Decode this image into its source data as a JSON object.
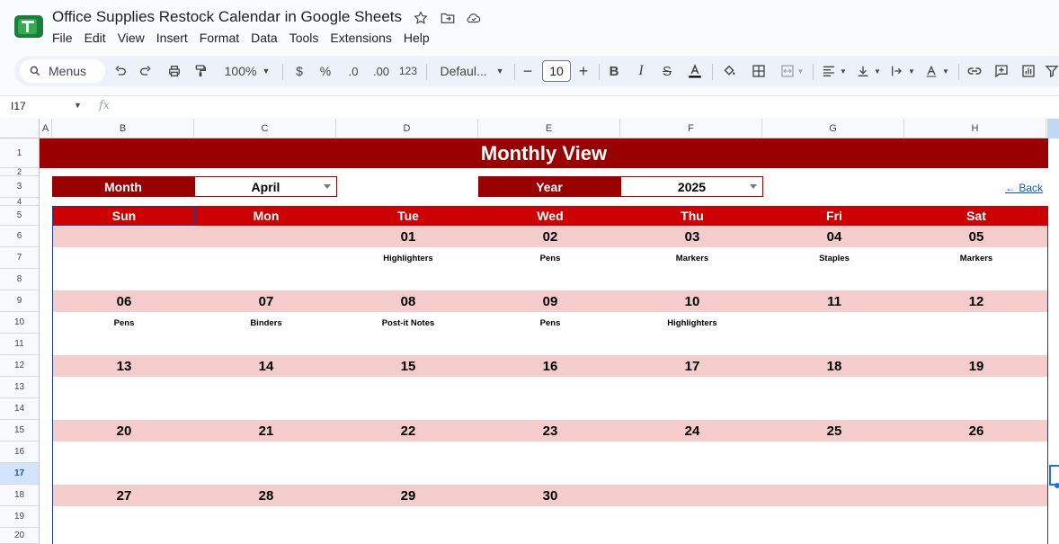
{
  "app": {
    "doc_title": "Office Supplies Restock Calendar in Google Sheets",
    "menu": [
      "File",
      "Edit",
      "View",
      "Insert",
      "Format",
      "Data",
      "Tools",
      "Extensions",
      "Help"
    ]
  },
  "toolbar": {
    "search_label": "Menus",
    "zoom": "100%",
    "currency": "$",
    "percent": "%",
    "dec_less": ".0",
    "dec_more": ".00",
    "number_format": "123",
    "font_family": "Defaul...",
    "font_size": "10"
  },
  "formula_bar": {
    "cell_ref": "I17",
    "fx_label": "fx"
  },
  "grid": {
    "columns": [
      "A",
      "B",
      "C",
      "D",
      "E",
      "F",
      "G",
      "H"
    ],
    "rows": [
      "1",
      "2",
      "3",
      "4",
      "5",
      "6",
      "7",
      "8",
      "9",
      "10",
      "11",
      "12",
      "13",
      "14",
      "15",
      "16",
      "17",
      "18",
      "19",
      "20"
    ],
    "active_row": "17"
  },
  "calendar": {
    "title": "Monthly View",
    "month_label": "Month",
    "month_value": "April",
    "year_label": "Year",
    "year_value": "2025",
    "back_link": "← Back",
    "days_of_week": [
      "Sun",
      "Mon",
      "Tue",
      "Wed",
      "Thu",
      "Fri",
      "Sat"
    ],
    "weeks": [
      {
        "dates": [
          "",
          "",
          "01",
          "02",
          "03",
          "04",
          "05"
        ],
        "items": [
          "",
          "",
          "Highlighters",
          "Pens",
          "Markers",
          "Staples",
          "Markers"
        ]
      },
      {
        "dates": [
          "06",
          "07",
          "08",
          "09",
          "10",
          "11",
          "12"
        ],
        "items": [
          "Pens",
          "Binders",
          "Post-it Notes",
          "Pens",
          "Highlighters",
          "",
          ""
        ]
      },
      {
        "dates": [
          "13",
          "14",
          "15",
          "16",
          "17",
          "18",
          "19"
        ],
        "items": [
          "",
          "",
          "",
          "",
          "",
          "",
          ""
        ]
      },
      {
        "dates": [
          "20",
          "21",
          "22",
          "23",
          "24",
          "25",
          "26"
        ],
        "items": [
          "",
          "",
          "",
          "",
          "",
          "",
          ""
        ]
      },
      {
        "dates": [
          "27",
          "28",
          "29",
          "30",
          "",
          "",
          ""
        ],
        "items": [
          "",
          "",
          "",
          "",
          "",
          "",
          ""
        ]
      }
    ]
  },
  "colors": {
    "banner": "#990000",
    "weekday_header": "#cc0000",
    "date_band": "#f4cccc",
    "link": "#1155cc"
  }
}
